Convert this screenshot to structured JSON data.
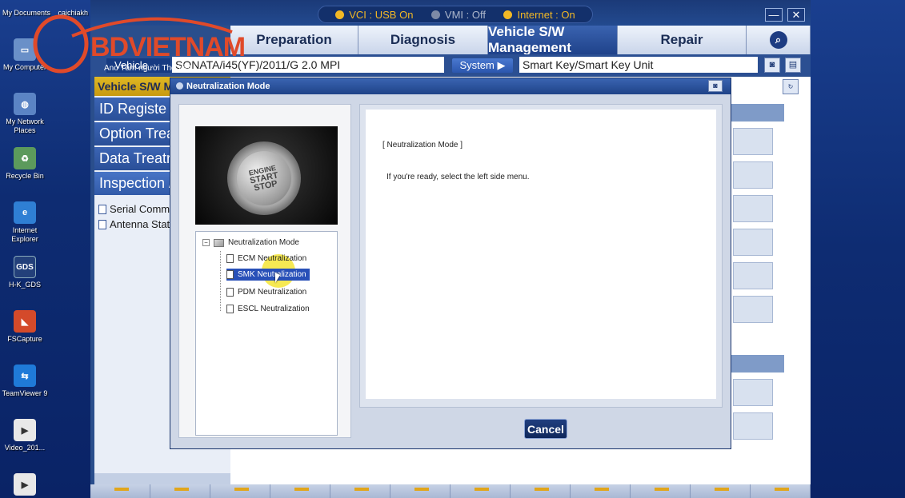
{
  "desktop": {
    "top_labels": [
      "My Documents",
      "caichiakh"
    ],
    "icons": [
      {
        "label": "My Computer",
        "icon": "computer-icon"
      },
      {
        "label": "My Network Places",
        "icon": "network-icon"
      },
      {
        "label": "Recycle Bin",
        "icon": "recycle-bin-icon"
      },
      {
        "label": "Internet Explorer",
        "icon": "ie-icon"
      },
      {
        "label": "H-K_GDS",
        "icon": "gds-icon",
        "badge": "GDS"
      },
      {
        "label": "FSCapture",
        "icon": "fscapture-icon"
      },
      {
        "label": "TeamViewer 9",
        "icon": "teamviewer-icon"
      },
      {
        "label": "Video_201...",
        "icon": "video-icon"
      }
    ]
  },
  "watermark": {
    "text": "BDVIETNAM",
    "subtext": "Ano Tâm người Thọ Việt"
  },
  "status": {
    "vci": "VCI : USB On",
    "vmi": "VMI : Off",
    "internet": "Internet : On",
    "colors": {
      "on": "#f2b825",
      "off": "#7d8aa6"
    }
  },
  "window_controls": {
    "minimize": "—",
    "close": "✕"
  },
  "tabs": [
    {
      "label": "Preparation",
      "active": false
    },
    {
      "label": "Diagnosis",
      "active": false
    },
    {
      "label": "Vehicle S/W Management",
      "active": true
    },
    {
      "label": "Repair",
      "active": false
    }
  ],
  "vehicle_bar": {
    "vehicle_label": "Vehicle",
    "vehicle_value": "SONATA/i45(YF)/2011/G 2.0 MPI",
    "system_button": "System",
    "system_value": "Smart Key/Smart Key Unit"
  },
  "left_panel": {
    "header": "Vehicle S/W M",
    "menu": [
      {
        "label": "ID Registe",
        "active": false
      },
      {
        "label": "Option Treatr",
        "active": false
      },
      {
        "label": "Data Treatr",
        "active": false
      },
      {
        "label": "Inspection /",
        "active": true
      }
    ],
    "sub_items": [
      "Serial Comm",
      "Antenna Stat"
    ]
  },
  "dialog": {
    "title": "Neutralization Mode",
    "photo_text": [
      "ENGINE",
      "START",
      "STOP"
    ],
    "tree": {
      "root": "Neutralization Mode",
      "nodes": [
        {
          "label": "ECM Neutralization",
          "selected": false
        },
        {
          "label": "SMK Neutralization",
          "selected": true
        },
        {
          "label": "PDM Neutralization",
          "selected": false
        },
        {
          "label": "ESCL Neutralization",
          "selected": false
        }
      ]
    },
    "message_title": "[ Neutralization Mode ]",
    "message_text": "If you're ready, select the left side menu.",
    "cancel_label": "Cancel"
  },
  "colors": {
    "accent": "#2a4f94",
    "highlight": "#f4e428",
    "selected": "#2850b8"
  }
}
